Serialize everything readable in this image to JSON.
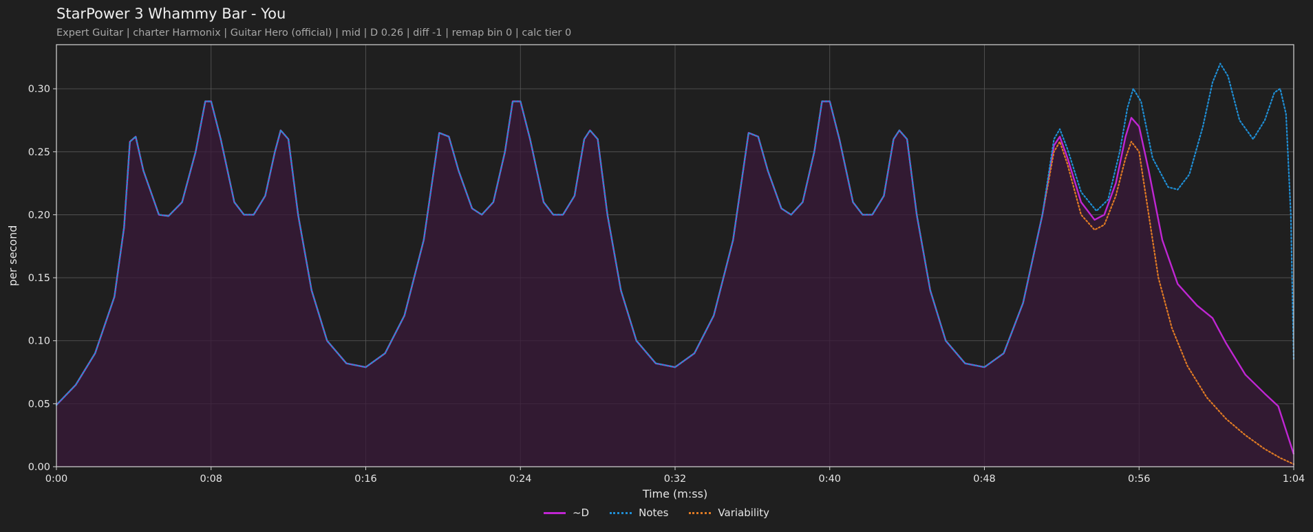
{
  "title": "StarPower 3 Whammy Bar - You",
  "subtitle": "Expert Guitar  |  charter Harmonix  |  Guitar Hero (official)  |  mid  |  D 0.26  |  diff -1  |  remap bin 0  |  calc tier 0",
  "chart_data": {
    "type": "line",
    "title": "StarPower 3 Whammy Bar - You",
    "xlabel": "Time (m:ss)",
    "ylabel": "per second",
    "xlim": [
      0,
      64
    ],
    "ylim": [
      0,
      0.335
    ],
    "x_ticks": [
      0,
      8,
      16,
      24,
      32,
      40,
      48,
      56,
      64
    ],
    "x_tick_labels": [
      "0:00",
      "0:08",
      "0:16",
      "0:24",
      "0:32",
      "0:40",
      "0:48",
      "0:56",
      "1:04"
    ],
    "y_ticks": [
      0,
      0.05,
      0.1,
      0.15,
      0.2,
      0.25,
      0.3
    ],
    "y_tick_labels": [
      "0.00",
      "0.05",
      "0.10",
      "0.15",
      "0.20",
      "0.25",
      "0.30"
    ],
    "grid": true,
    "legend_position": "bottom-center",
    "series": [
      {
        "name": "~D",
        "color": "#c026d3",
        "style": "solid",
        "filled": true,
        "points": [
          [
            0,
            0.049
          ],
          [
            1,
            0.065
          ],
          [
            2,
            0.09
          ],
          [
            3,
            0.135
          ],
          [
            3.5,
            0.19
          ],
          [
            3.8,
            0.258
          ],
          [
            4.1,
            0.262
          ],
          [
            4.5,
            0.235
          ],
          [
            5.3,
            0.2
          ],
          [
            5.8,
            0.199
          ],
          [
            6.5,
            0.21
          ],
          [
            7.2,
            0.25
          ],
          [
            7.7,
            0.29
          ],
          [
            8,
            0.29
          ],
          [
            8.5,
            0.26
          ],
          [
            9.2,
            0.21
          ],
          [
            9.7,
            0.2
          ],
          [
            10.2,
            0.2
          ],
          [
            10.8,
            0.215
          ],
          [
            11.3,
            0.25
          ],
          [
            11.6,
            0.267
          ],
          [
            12,
            0.26
          ],
          [
            12.5,
            0.2
          ],
          [
            13.2,
            0.14
          ],
          [
            14,
            0.1
          ],
          [
            15,
            0.082
          ],
          [
            16,
            0.079
          ],
          [
            17,
            0.09
          ],
          [
            18,
            0.12
          ],
          [
            19,
            0.18
          ],
          [
            19.8,
            0.265
          ],
          [
            20.3,
            0.262
          ],
          [
            20.8,
            0.235
          ],
          [
            21.5,
            0.205
          ],
          [
            22,
            0.2
          ],
          [
            22.6,
            0.21
          ],
          [
            23.2,
            0.25
          ],
          [
            23.6,
            0.29
          ],
          [
            24,
            0.29
          ],
          [
            24.5,
            0.26
          ],
          [
            25.2,
            0.21
          ],
          [
            25.7,
            0.2
          ],
          [
            26.2,
            0.2
          ],
          [
            26.8,
            0.215
          ],
          [
            27.3,
            0.26
          ],
          [
            27.6,
            0.267
          ],
          [
            28,
            0.26
          ],
          [
            28.5,
            0.2
          ],
          [
            29.2,
            0.14
          ],
          [
            30,
            0.1
          ],
          [
            31,
            0.082
          ],
          [
            32,
            0.079
          ],
          [
            33,
            0.09
          ],
          [
            34,
            0.12
          ],
          [
            35,
            0.18
          ],
          [
            35.8,
            0.265
          ],
          [
            36.3,
            0.262
          ],
          [
            36.8,
            0.235
          ],
          [
            37.5,
            0.205
          ],
          [
            38,
            0.2
          ],
          [
            38.6,
            0.21
          ],
          [
            39.2,
            0.25
          ],
          [
            39.6,
            0.29
          ],
          [
            40,
            0.29
          ],
          [
            40.5,
            0.26
          ],
          [
            41.2,
            0.21
          ],
          [
            41.7,
            0.2
          ],
          [
            42.2,
            0.2
          ],
          [
            42.8,
            0.215
          ],
          [
            43.3,
            0.26
          ],
          [
            43.6,
            0.267
          ],
          [
            44,
            0.26
          ],
          [
            44.5,
            0.2
          ],
          [
            45.2,
            0.14
          ],
          [
            46,
            0.1
          ],
          [
            47,
            0.082
          ],
          [
            48,
            0.079
          ],
          [
            49,
            0.09
          ],
          [
            50,
            0.13
          ],
          [
            51,
            0.2
          ],
          [
            51.6,
            0.255
          ],
          [
            51.9,
            0.262
          ],
          [
            52.3,
            0.245
          ],
          [
            53,
            0.21
          ],
          [
            53.7,
            0.196
          ],
          [
            54.2,
            0.2
          ],
          [
            54.8,
            0.225
          ],
          [
            55.3,
            0.262
          ],
          [
            55.6,
            0.277
          ],
          [
            56,
            0.27
          ],
          [
            56.5,
            0.235
          ],
          [
            57.2,
            0.18
          ],
          [
            58,
            0.145
          ],
          [
            59,
            0.128
          ],
          [
            59.8,
            0.118
          ],
          [
            60.5,
            0.098
          ],
          [
            61.5,
            0.073
          ],
          [
            62.5,
            0.058
          ],
          [
            63.2,
            0.048
          ],
          [
            64,
            0.01
          ]
        ]
      },
      {
        "name": "Notes",
        "color": "#1f8fd6",
        "style": "dotted",
        "points": [
          [
            0,
            0.049
          ],
          [
            1,
            0.065
          ],
          [
            2,
            0.09
          ],
          [
            3,
            0.135
          ],
          [
            3.5,
            0.19
          ],
          [
            3.8,
            0.258
          ],
          [
            4.1,
            0.262
          ],
          [
            4.5,
            0.235
          ],
          [
            5.3,
            0.2
          ],
          [
            5.8,
            0.199
          ],
          [
            6.5,
            0.21
          ],
          [
            7.2,
            0.25
          ],
          [
            7.7,
            0.29
          ],
          [
            8,
            0.29
          ],
          [
            8.5,
            0.26
          ],
          [
            9.2,
            0.21
          ],
          [
            9.7,
            0.2
          ],
          [
            10.2,
            0.2
          ],
          [
            10.8,
            0.215
          ],
          [
            11.3,
            0.25
          ],
          [
            11.6,
            0.267
          ],
          [
            12,
            0.26
          ],
          [
            12.5,
            0.2
          ],
          [
            13.2,
            0.14
          ],
          [
            14,
            0.1
          ],
          [
            15,
            0.082
          ],
          [
            16,
            0.079
          ],
          [
            17,
            0.09
          ],
          [
            18,
            0.12
          ],
          [
            19,
            0.18
          ],
          [
            19.8,
            0.265
          ],
          [
            20.3,
            0.262
          ],
          [
            20.8,
            0.235
          ],
          [
            21.5,
            0.205
          ],
          [
            22,
            0.2
          ],
          [
            22.6,
            0.21
          ],
          [
            23.2,
            0.25
          ],
          [
            23.6,
            0.29
          ],
          [
            24,
            0.29
          ],
          [
            24.5,
            0.26
          ],
          [
            25.2,
            0.21
          ],
          [
            25.7,
            0.2
          ],
          [
            26.2,
            0.2
          ],
          [
            26.8,
            0.215
          ],
          [
            27.3,
            0.26
          ],
          [
            27.6,
            0.267
          ],
          [
            28,
            0.26
          ],
          [
            28.5,
            0.2
          ],
          [
            29.2,
            0.14
          ],
          [
            30,
            0.1
          ],
          [
            31,
            0.082
          ],
          [
            32,
            0.079
          ],
          [
            33,
            0.09
          ],
          [
            34,
            0.12
          ],
          [
            35,
            0.18
          ],
          [
            35.8,
            0.265
          ],
          [
            36.3,
            0.262
          ],
          [
            36.8,
            0.235
          ],
          [
            37.5,
            0.205
          ],
          [
            38,
            0.2
          ],
          [
            38.6,
            0.21
          ],
          [
            39.2,
            0.25
          ],
          [
            39.6,
            0.29
          ],
          [
            40,
            0.29
          ],
          [
            40.5,
            0.26
          ],
          [
            41.2,
            0.21
          ],
          [
            41.7,
            0.2
          ],
          [
            42.2,
            0.2
          ],
          [
            42.8,
            0.215
          ],
          [
            43.3,
            0.26
          ],
          [
            43.6,
            0.267
          ],
          [
            44,
            0.26
          ],
          [
            44.5,
            0.2
          ],
          [
            45.2,
            0.14
          ],
          [
            46,
            0.1
          ],
          [
            47,
            0.082
          ],
          [
            48,
            0.079
          ],
          [
            49,
            0.09
          ],
          [
            50,
            0.13
          ],
          [
            51,
            0.2
          ],
          [
            51.6,
            0.26
          ],
          [
            51.9,
            0.268
          ],
          [
            52.3,
            0.252
          ],
          [
            53,
            0.218
          ],
          [
            53.8,
            0.203
          ],
          [
            54.4,
            0.212
          ],
          [
            55,
            0.25
          ],
          [
            55.4,
            0.285
          ],
          [
            55.7,
            0.3
          ],
          [
            56.1,
            0.29
          ],
          [
            56.7,
            0.245
          ],
          [
            57.5,
            0.222
          ],
          [
            58,
            0.22
          ],
          [
            58.6,
            0.232
          ],
          [
            59.3,
            0.27
          ],
          [
            59.8,
            0.305
          ],
          [
            60.2,
            0.32
          ],
          [
            60.6,
            0.31
          ],
          [
            61.2,
            0.275
          ],
          [
            61.9,
            0.26
          ],
          [
            62.5,
            0.275
          ],
          [
            63,
            0.297
          ],
          [
            63.3,
            0.3
          ],
          [
            63.6,
            0.28
          ],
          [
            63.85,
            0.2
          ],
          [
            64,
            0.085
          ]
        ]
      },
      {
        "name": "Variability",
        "color": "#e07b24",
        "style": "dotted",
        "points": [
          [
            0,
            0.049
          ],
          [
            1,
            0.065
          ],
          [
            2,
            0.09
          ],
          [
            3,
            0.135
          ],
          [
            3.5,
            0.19
          ],
          [
            3.8,
            0.258
          ],
          [
            4.1,
            0.262
          ],
          [
            4.5,
            0.235
          ],
          [
            5.3,
            0.2
          ],
          [
            5.8,
            0.199
          ],
          [
            6.5,
            0.21
          ],
          [
            7.2,
            0.25
          ],
          [
            7.7,
            0.29
          ],
          [
            8,
            0.29
          ],
          [
            8.5,
            0.26
          ],
          [
            9.2,
            0.21
          ],
          [
            9.7,
            0.2
          ],
          [
            10.2,
            0.2
          ],
          [
            10.8,
            0.215
          ],
          [
            11.3,
            0.25
          ],
          [
            11.6,
            0.267
          ],
          [
            12,
            0.26
          ],
          [
            12.5,
            0.2
          ],
          [
            13.2,
            0.14
          ],
          [
            14,
            0.1
          ],
          [
            15,
            0.082
          ],
          [
            16,
            0.079
          ],
          [
            17,
            0.09
          ],
          [
            18,
            0.12
          ],
          [
            19,
            0.18
          ],
          [
            19.8,
            0.265
          ],
          [
            20.3,
            0.262
          ],
          [
            20.8,
            0.235
          ],
          [
            21.5,
            0.205
          ],
          [
            22,
            0.2
          ],
          [
            22.6,
            0.21
          ],
          [
            23.2,
            0.25
          ],
          [
            23.6,
            0.29
          ],
          [
            24,
            0.29
          ],
          [
            24.5,
            0.26
          ],
          [
            25.2,
            0.21
          ],
          [
            25.7,
            0.2
          ],
          [
            26.2,
            0.2
          ],
          [
            26.8,
            0.215
          ],
          [
            27.3,
            0.26
          ],
          [
            27.6,
            0.267
          ],
          [
            28,
            0.26
          ],
          [
            28.5,
            0.2
          ],
          [
            29.2,
            0.14
          ],
          [
            30,
            0.1
          ],
          [
            31,
            0.082
          ],
          [
            32,
            0.079
          ],
          [
            33,
            0.09
          ],
          [
            34,
            0.12
          ],
          [
            35,
            0.18
          ],
          [
            35.8,
            0.265
          ],
          [
            36.3,
            0.262
          ],
          [
            36.8,
            0.235
          ],
          [
            37.5,
            0.205
          ],
          [
            38,
            0.2
          ],
          [
            38.6,
            0.21
          ],
          [
            39.2,
            0.25
          ],
          [
            39.6,
            0.29
          ],
          [
            40,
            0.29
          ],
          [
            40.5,
            0.26
          ],
          [
            41.2,
            0.21
          ],
          [
            41.7,
            0.2
          ],
          [
            42.2,
            0.2
          ],
          [
            42.8,
            0.215
          ],
          [
            43.3,
            0.26
          ],
          [
            43.6,
            0.267
          ],
          [
            44,
            0.26
          ],
          [
            44.5,
            0.2
          ],
          [
            45.2,
            0.14
          ],
          [
            46,
            0.1
          ],
          [
            47,
            0.082
          ],
          [
            48,
            0.079
          ],
          [
            49,
            0.09
          ],
          [
            50,
            0.13
          ],
          [
            51,
            0.2
          ],
          [
            51.6,
            0.25
          ],
          [
            51.9,
            0.258
          ],
          [
            52.3,
            0.24
          ],
          [
            53,
            0.2
          ],
          [
            53.7,
            0.188
          ],
          [
            54.2,
            0.192
          ],
          [
            54.8,
            0.215
          ],
          [
            55.3,
            0.245
          ],
          [
            55.6,
            0.258
          ],
          [
            56,
            0.25
          ],
          [
            56.5,
            0.2
          ],
          [
            57,
            0.15
          ],
          [
            57.7,
            0.11
          ],
          [
            58.5,
            0.08
          ],
          [
            59.5,
            0.055
          ],
          [
            60.5,
            0.038
          ],
          [
            61.5,
            0.025
          ],
          [
            62.5,
            0.014
          ],
          [
            63.3,
            0.007
          ],
          [
            64,
            0.002
          ]
        ]
      }
    ]
  }
}
